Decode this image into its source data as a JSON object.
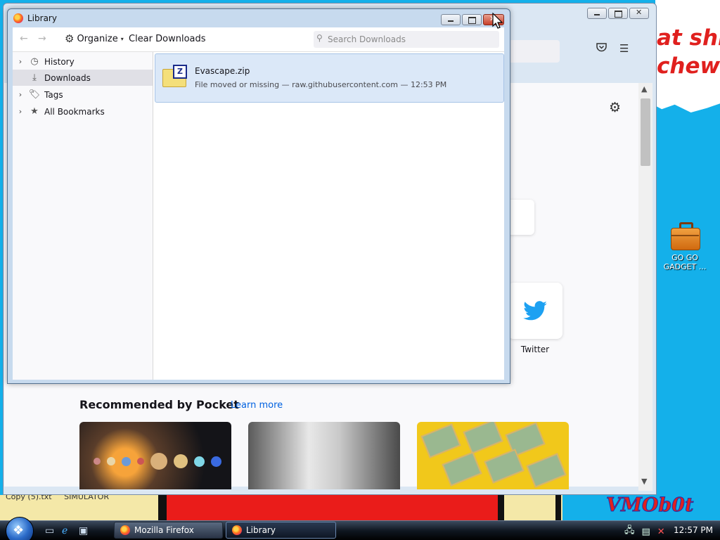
{
  "desktop": {
    "wall_text_top": "at shi",
    "wall_text_bottom": "chew",
    "signature": "VMOb0t",
    "files": [
      "Copy (5).txt",
      "SIMULATOR"
    ],
    "icon_label": "GO GO GADGET ..."
  },
  "firefox": {
    "twitter_label": "Twitter",
    "pocket_title": "Recommended by Pocket",
    "pocket_learn_more": "Learn more"
  },
  "library": {
    "title": "Library",
    "organize_label": "Organize",
    "clear_downloads_label": "Clear Downloads",
    "search_placeholder": "Search Downloads",
    "sidebar": [
      {
        "label": "History",
        "icon": "clock-icon",
        "expandable": true
      },
      {
        "label": "Downloads",
        "icon": "download-icon",
        "expandable": false,
        "active": true
      },
      {
        "label": "Tags",
        "icon": "tag-icon",
        "expandable": true
      },
      {
        "label": "All Bookmarks",
        "icon": "star-icon",
        "expandable": true
      }
    ],
    "downloads": [
      {
        "name": "Evascape.zip",
        "status": "File moved or missing — raw.githubusercontent.com — 12:53 PM"
      }
    ]
  },
  "taskbar": {
    "buttons": [
      {
        "label": "Mozilla Firefox"
      },
      {
        "label": "Library"
      }
    ],
    "clock": "12:57 PM"
  },
  "colors": {
    "desktop_bg": "#14b0ea",
    "selected_download": "#dbe8f8",
    "link": "#0061e0"
  }
}
